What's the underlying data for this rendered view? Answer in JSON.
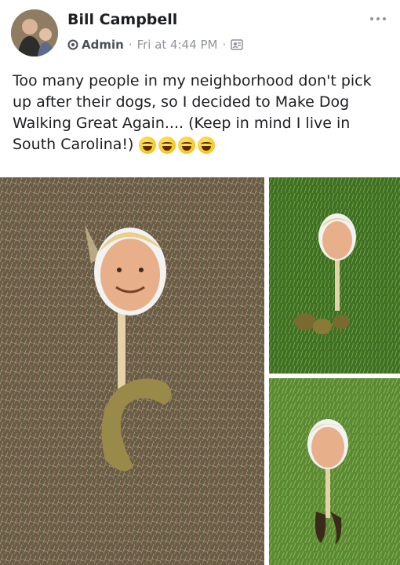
{
  "post": {
    "author": "Bill Campbell",
    "role": "Admin",
    "timestamp": "Fri at 4:44 PM",
    "privacy_icon": "group-audience-icon",
    "body": "Too many people in my neighborhood don't pick up after their dogs, so I decided to Make Dog Walking Great Again.... (Keep in mind I live in South Carolina!)",
    "emojis": [
      "grinning-squinting-icon",
      "rolling-laughing-icon",
      "grinning-squinting-icon",
      "rolling-laughing-icon"
    ]
  },
  "colors": {
    "text": "#1c1e21",
    "meta": "#90949c",
    "grass_dry": "#6e5e4a",
    "grass_green": "#4d7a2e"
  },
  "photos": {
    "count": 3
  }
}
